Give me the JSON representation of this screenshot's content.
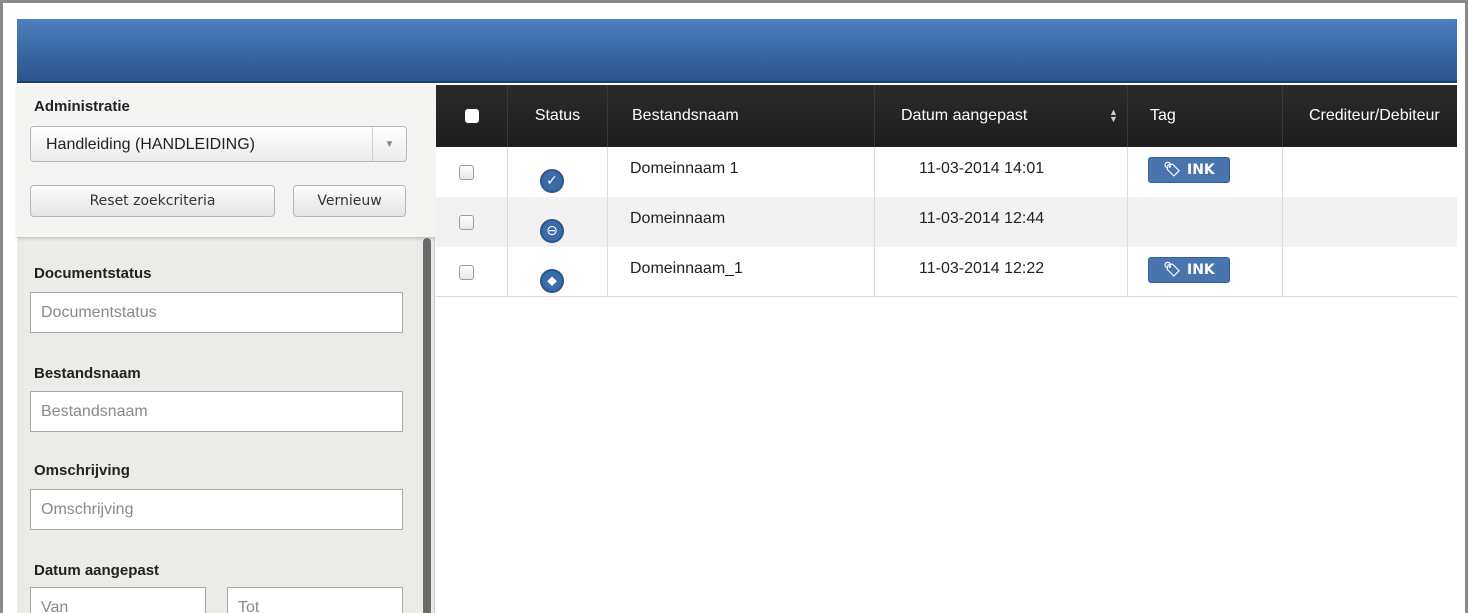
{
  "sidebar": {
    "administratie_label": "Administratie",
    "administratie_value": "Handleiding (HANDLEIDING)",
    "reset_label": "Reset zoekcriteria",
    "refresh_label": "Vernieuw",
    "documentstatus": {
      "label": "Documentstatus",
      "placeholder": "Documentstatus"
    },
    "bestandsnaam": {
      "label": "Bestandsnaam",
      "placeholder": "Bestandsnaam"
    },
    "omschrijving": {
      "label": "Omschrijving",
      "placeholder": "Omschrijving"
    },
    "datum": {
      "label": "Datum aangepast",
      "from_placeholder": "Van",
      "to_placeholder": "Tot"
    }
  },
  "grid": {
    "columns": {
      "status": "Status",
      "bestandsnaam": "Bestandsnaam",
      "datum": "Datum aangepast",
      "tag": "Tag",
      "crediteur": "Crediteur/Debiteur"
    },
    "rows": [
      {
        "status_icon": "check-circle-icon",
        "bestandsnaam": "Domeinnaam 1",
        "datum": "11-03-2014 14:01",
        "tag": "INK"
      },
      {
        "status_icon": "minus-circle-icon",
        "bestandsnaam": "Domeinnaam",
        "datum": "11-03-2014 12:44",
        "tag": ""
      },
      {
        "status_icon": "tag-circle-icon",
        "bestandsnaam": "Domeinnaam_1",
        "datum": "11-03-2014 12:22",
        "tag": "INK"
      }
    ]
  },
  "colors": {
    "topbar": "#3b6aa9",
    "grid_header": "#222222",
    "tag_badge": "#4a74ad"
  }
}
